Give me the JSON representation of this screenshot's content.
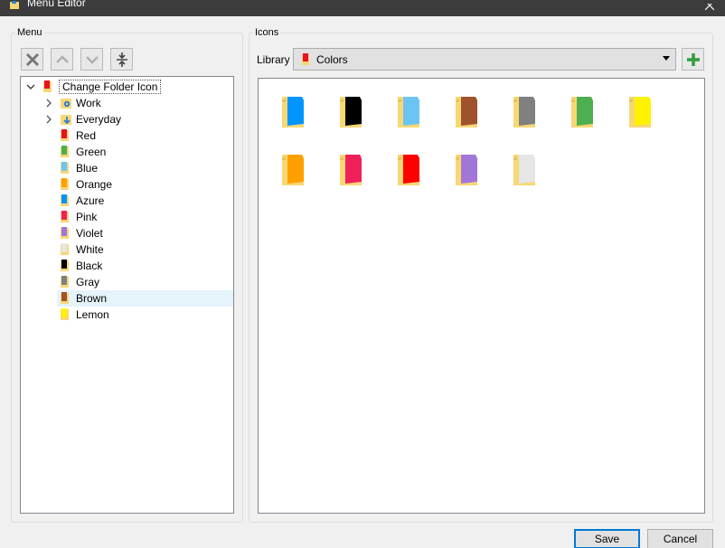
{
  "window": {
    "title": "Menu Editor"
  },
  "menu_group": {
    "legend": "Menu"
  },
  "icons_group": {
    "legend": "Icons"
  },
  "tree": {
    "root": {
      "label": "Change Folder Icon",
      "color": "#e81123"
    },
    "items": [
      {
        "label": "Work",
        "kind": "submenu",
        "icon": "gear-folder-icon"
      },
      {
        "label": "Everyday",
        "kind": "submenu",
        "icon": "download-folder-icon"
      },
      {
        "label": "Red",
        "color": "#e81123"
      },
      {
        "label": "Green",
        "color": "#4caf50"
      },
      {
        "label": "Blue",
        "color": "#6cc4f5"
      },
      {
        "label": "Orange",
        "color": "#ff9f00"
      },
      {
        "label": "Azure",
        "color": "#0095ff"
      },
      {
        "label": "Pink",
        "color": "#f0205a"
      },
      {
        "label": "Violet",
        "color": "#a276d9"
      },
      {
        "label": "White",
        "color": "#e6e6e6"
      },
      {
        "label": "Black",
        "color": "#000000"
      },
      {
        "label": "Gray",
        "color": "#808080"
      },
      {
        "label": "Brown",
        "color": "#a0522d",
        "selected": true
      },
      {
        "label": "Lemon",
        "color": "#fff200"
      }
    ]
  },
  "library": {
    "label": "Library",
    "selected": "Colors",
    "selected_color": "#e81123"
  },
  "icon_grid": [
    {
      "color": "#0095ff"
    },
    {
      "color": "#000000"
    },
    {
      "color": "#6cc4f5"
    },
    {
      "color": "#a0522d"
    },
    {
      "color": "#808080"
    },
    {
      "color": "#4caf50"
    },
    {
      "color": "#fff200"
    },
    {
      "color": "#ff9f00"
    },
    {
      "color": "#f0205a"
    },
    {
      "color": "#ff0000"
    },
    {
      "color": "#a276d9"
    },
    {
      "color": "#e6e6e6"
    }
  ],
  "buttons": {
    "save": "Save",
    "cancel": "Cancel"
  },
  "colors": {
    "accent": "#0078d7",
    "add_green": "#2e9e3e",
    "folder_body": "#f8d775"
  }
}
